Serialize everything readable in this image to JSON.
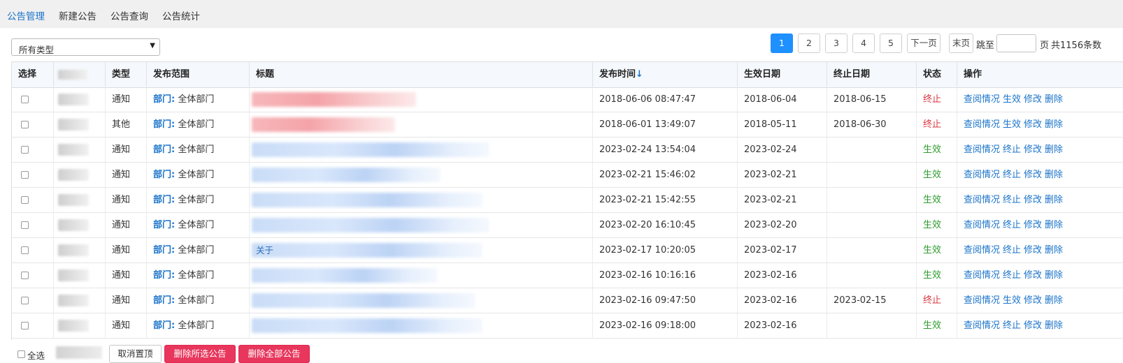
{
  "nav": {
    "tabs": [
      {
        "label": "公告管理",
        "active": true
      },
      {
        "label": "新建公告",
        "active": false
      },
      {
        "label": "公告查询",
        "active": false
      },
      {
        "label": "公告统计",
        "active": false
      }
    ]
  },
  "filter": {
    "type_select_value": "所有类型",
    "caret_icon": "chevron-down-icon"
  },
  "pagination": {
    "pages": [
      "1",
      "2",
      "3",
      "4",
      "5"
    ],
    "current_page": "1",
    "next_label": "下一页",
    "last_label": "末页",
    "jump_label": "跳至",
    "page_unit": "页",
    "total_text": "共1156条数"
  },
  "table": {
    "headers": {
      "select": "选择",
      "type": "类型",
      "scope": "发布范围",
      "title": "标题",
      "publish_time": "发布时间",
      "effective_date": "生效日期",
      "end_date": "终止日期",
      "status": "状态",
      "actions": "操作"
    },
    "sort_arrow": "↓",
    "scope_key": "部门:",
    "rows": [
      {
        "type": "通知",
        "scope": "全体部门",
        "title_style": "red",
        "title_text": "",
        "publish_time": "2018-06-06 08:47:47",
        "effective": "2018-06-04",
        "end": "2018-06-15",
        "status": "终止",
        "status_kind": "stop",
        "actions": [
          "查阅情况",
          "生效",
          "修改",
          "删除"
        ]
      },
      {
        "type": "其他",
        "scope": "全体部门",
        "title_style": "red",
        "title_text": "",
        "publish_time": "2018-06-01 13:49:07",
        "effective": "2018-05-11",
        "end": "2018-06-30",
        "status": "终止",
        "status_kind": "stop",
        "actions": [
          "查阅情况",
          "生效",
          "修改",
          "删除"
        ]
      },
      {
        "type": "通知",
        "scope": "全体部门",
        "title_style": "blue",
        "title_text": "",
        "publish_time": "2023-02-24 13:54:04",
        "effective": "2023-02-24",
        "end": "",
        "status": "生效",
        "status_kind": "ok",
        "actions": [
          "查阅情况",
          "终止",
          "修改",
          "删除"
        ]
      },
      {
        "type": "通知",
        "scope": "全体部门",
        "title_style": "blue",
        "title_text": "",
        "publish_time": "2023-02-21 15:46:02",
        "effective": "2023-02-21",
        "end": "",
        "status": "生效",
        "status_kind": "ok",
        "actions": [
          "查阅情况",
          "终止",
          "修改",
          "删除"
        ]
      },
      {
        "type": "通知",
        "scope": "全体部门",
        "title_style": "blue",
        "title_text": "",
        "publish_time": "2023-02-21 15:42:55",
        "effective": "2023-02-21",
        "end": "",
        "status": "生效",
        "status_kind": "ok",
        "actions": [
          "查阅情况",
          "终止",
          "修改",
          "删除"
        ]
      },
      {
        "type": "通知",
        "scope": "全体部门",
        "title_style": "blue",
        "title_text": "",
        "publish_time": "2023-02-20 16:10:45",
        "effective": "2023-02-20",
        "end": "",
        "status": "生效",
        "status_kind": "ok",
        "actions": [
          "查阅情况",
          "终止",
          "修改",
          "删除"
        ]
      },
      {
        "type": "通知",
        "scope": "全体部门",
        "title_style": "blue",
        "title_text": "关于",
        "publish_time": "2023-02-17 10:20:05",
        "effective": "2023-02-17",
        "end": "",
        "status": "生效",
        "status_kind": "ok",
        "actions": [
          "查阅情况",
          "终止",
          "修改",
          "删除"
        ]
      },
      {
        "type": "通知",
        "scope": "全体部门",
        "title_style": "blue",
        "title_text": "",
        "publish_time": "2023-02-16 10:16:16",
        "effective": "2023-02-16",
        "end": "",
        "status": "生效",
        "status_kind": "ok",
        "actions": [
          "查阅情况",
          "终止",
          "修改",
          "删除"
        ]
      },
      {
        "type": "通知",
        "scope": "全体部门",
        "title_style": "blue",
        "title_text": "",
        "publish_time": "2023-02-16 09:47:50",
        "effective": "2023-02-16",
        "end": "2023-02-15",
        "status": "终止",
        "status_kind": "stop",
        "actions": [
          "查阅情况",
          "生效",
          "修改",
          "删除"
        ]
      },
      {
        "type": "通知",
        "scope": "全体部门",
        "title_style": "blue",
        "title_text": "",
        "publish_time": "2023-02-16 09:18:00",
        "effective": "2023-02-16",
        "end": "",
        "status": "生效",
        "status_kind": "ok",
        "actions": [
          "查阅情况",
          "终止",
          "修改",
          "删除"
        ]
      }
    ]
  },
  "footer": {
    "select_all_label": "全选",
    "cancel_pin_label": "取消置顶",
    "delete_selected_label": "删除所选公告",
    "delete_all_label": "删除全部公告"
  },
  "colors": {
    "accent": "#1a73c9",
    "status_stop": "#d9363e",
    "status_ok": "#2e9b2e",
    "danger": "#e8365c"
  }
}
